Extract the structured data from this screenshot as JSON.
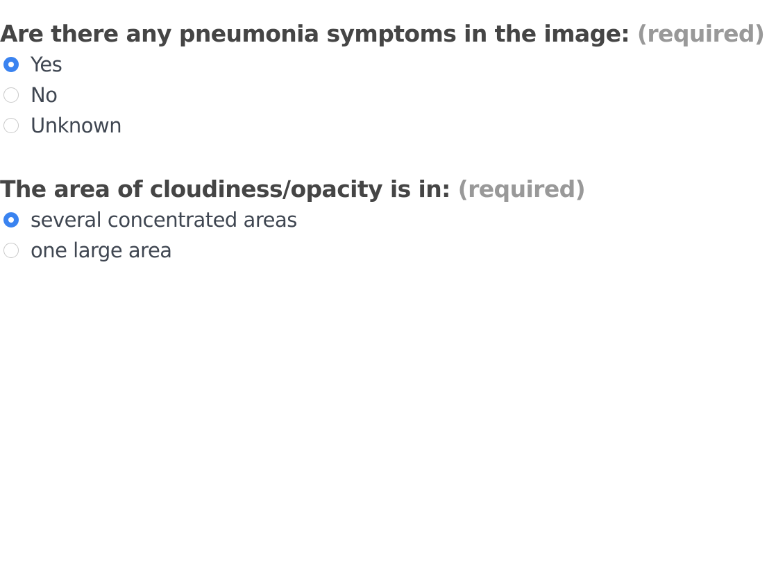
{
  "questions": [
    {
      "title": "Are there any pneumonia symptoms in the image:",
      "required_text": "(required)",
      "options": [
        {
          "label": "Yes",
          "checked": true
        },
        {
          "label": "No",
          "checked": false
        },
        {
          "label": "Unknown",
          "checked": false
        }
      ]
    },
    {
      "title": "The area of cloudiness/opacity is in:",
      "required_text": "(required)",
      "options": [
        {
          "label": "several concentrated areas",
          "checked": true
        },
        {
          "label": "one large area",
          "checked": false
        }
      ]
    }
  ],
  "colors": {
    "accent": "#3a83f0",
    "required": "#999999",
    "text": "#454545"
  }
}
